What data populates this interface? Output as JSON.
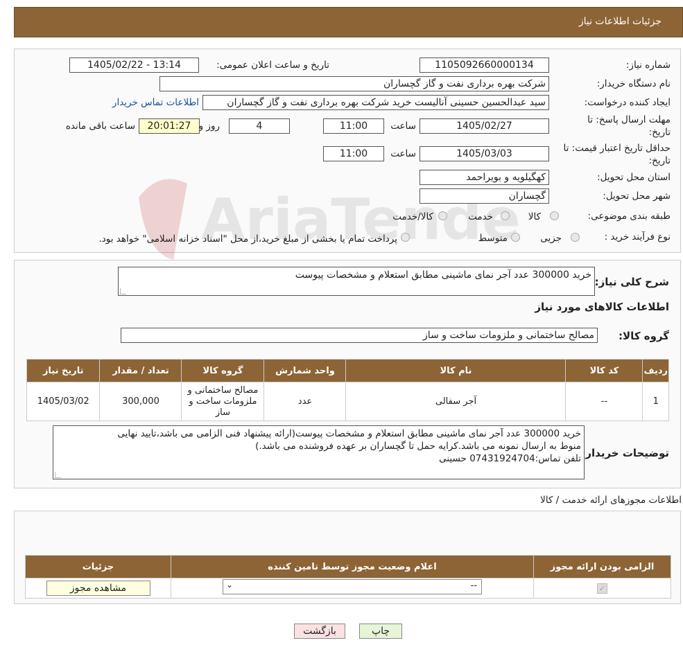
{
  "header": {
    "title": "جزئیات اطلاعات نیاز"
  },
  "fields": {
    "need_number_label": "شماره نیاز:",
    "need_number": "1105092660000134",
    "announce_label": "تاریخ و ساعت اعلان عمومی:",
    "announce_value": "1405/02/22 - 13:14",
    "buyer_org_label": "نام دستگاه خریدار:",
    "buyer_org": "شرکت بهره برداری نفت و گاز گچساران",
    "creator_label": "ایجاد کننده درخواست:",
    "creator": "سید عبدالحسین حسینی آنالیست خرید شرکت بهره برداری نفت و گاز گچساران",
    "contact_link": "اطلاعات تماس خریدار",
    "reply_deadline_label": "مهلت ارسال پاسخ: تا تاریخ:",
    "reply_date": "1405/02/27",
    "time_label": "ساعت",
    "reply_time": "11:00",
    "days_value": "4",
    "days_label": "روز و",
    "remaining_time": "20:01:27",
    "remaining_label": "ساعت باقی مانده",
    "price_validity_label": "حداقل تاریخ اعتبار قیمت: تا تاریخ:",
    "validity_date": "1405/03/03",
    "validity_time": "11:00",
    "province_label": "استان محل تحویل:",
    "province": "کهگیلویه و بویراحمد",
    "city_label": "شهر محل تحویل:",
    "city": "گچساران",
    "category_label": "طبقه بندی موضوعی:",
    "category_options": [
      "کالا",
      "خدمت",
      "کالا/خدمت"
    ],
    "process_label": "نوع فرآیند خرید :",
    "process_options": [
      "جزیی",
      "متوسط"
    ],
    "process_note": "پرداخت تمام یا بخشی از مبلغ خرید،از محل \"اسناد خزانه اسلامی\" خواهد بود."
  },
  "summary": {
    "description_label": "شرح کلی نیاز:",
    "description": "خرید 300000 عدد آجر نمای ماشینی مطابق استعلام  و مشخصات پیوست",
    "goods_info_title": "اطلاعات کالاهای مورد نیاز",
    "goods_group_label": "گروه کالا:",
    "goods_group": "مصالح ساختمانی و ملزومات ساخت و ساز"
  },
  "goods_table": {
    "headers": [
      "ردیف",
      "کد کالا",
      "نام کالا",
      "واحد شمارش",
      "گروه کالا",
      "تعداد / مقدار",
      "تاریخ نیاز"
    ],
    "rows": [
      [
        "1",
        "--",
        "آجر سفالی",
        "عدد",
        "مصالح ساختمانی و ملزومات ساخت و ساز",
        "300,000",
        "1405/03/02"
      ]
    ]
  },
  "buyer_notes": {
    "label": "توضیحات خریدار:",
    "line1": "خرید 300000 عدد آجر نمای ماشینی مطابق استعلام  و مشخصات پیوست(ارائه پیشنهاد فنی الزامی می باشد،تایید نهایی",
    "line2": "منوط به ارسال نمونه می باشد.کرایه حمل تا گچساران بر عهده فروشنده می باشد.)",
    "line3": "تلفن تماس:07431924704  حسینی"
  },
  "permits": {
    "title": "اطلاعات مجوزهای ارائه خدمت / کالا",
    "headers": [
      "الزامی بودن ارائه مجوز",
      "اعلام وضعیت مجوز توسط تامین کننده",
      "جزئیات"
    ],
    "select_value": "--",
    "view_button": "مشاهده مجوز"
  },
  "buttons": {
    "print": "چاپ",
    "back": "بازگشت"
  },
  "watermark_text": "AriaTender.neT"
}
